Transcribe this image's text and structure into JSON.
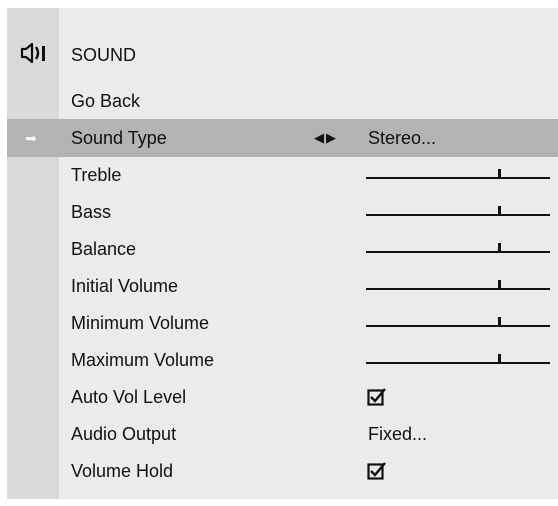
{
  "menu": {
    "title": "SOUND",
    "icon": "speaker-icon",
    "items": [
      {
        "label": "Go Back",
        "type": "plain"
      },
      {
        "label": "Sound Type",
        "type": "choice",
        "value": "Stereo...",
        "selected": true
      },
      {
        "label": "Treble",
        "type": "slider",
        "level": 0.72
      },
      {
        "label": "Bass",
        "type": "slider",
        "level": 0.72
      },
      {
        "label": "Balance",
        "type": "slider",
        "level": 0.72
      },
      {
        "label": "Initial Volume",
        "type": "slider",
        "level": 0.72
      },
      {
        "label": "Minimum Volume",
        "type": "slider",
        "level": 0.72
      },
      {
        "label": "Maximum Volume",
        "type": "slider",
        "level": 0.72
      },
      {
        "label": "Auto Vol Level",
        "type": "checkbox",
        "checked": true
      },
      {
        "label": "Audio Output",
        "type": "choice",
        "value": "Fixed..."
      },
      {
        "label": "Volume Hold",
        "type": "checkbox",
        "checked": true
      }
    ]
  },
  "colors": {
    "panel_bg": "#ebebeb",
    "sidebar_bg": "#d9d9d9",
    "selected_row_bg": "#b3b3b3"
  }
}
